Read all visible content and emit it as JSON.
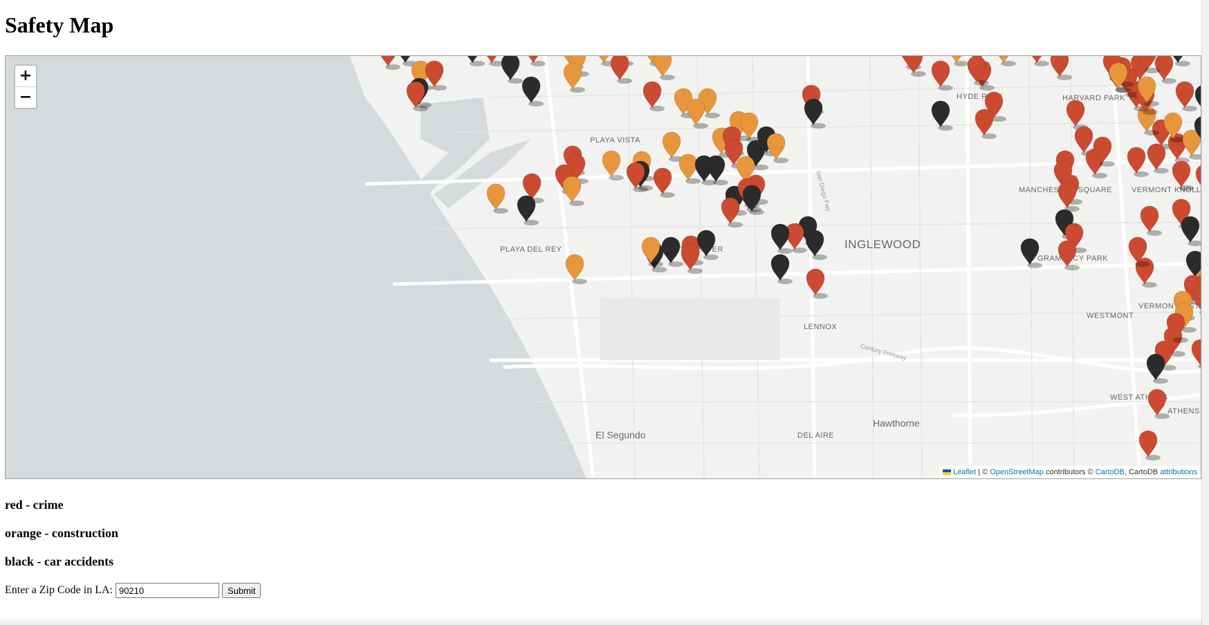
{
  "page": {
    "title": "Safety Map"
  },
  "map": {
    "zoom_in_label": "+",
    "zoom_out_label": "−",
    "place_labels": [
      "PLAYA VISTA",
      "PLAYA DEL REY",
      "WESTCHESTER",
      "INGLEWOOD",
      "HYDE PARK",
      "HARVARD PARK",
      "MANCHESTER SQUARE",
      "VERMONT KNOLLS",
      "GRAMERCY PARK",
      "WESTMONT",
      "VERMONT VISTA",
      "LENNOX",
      "WEST ATHENS",
      "ATHENS",
      "El Segundo",
      "Hawthorne",
      "DEL AIRE",
      "Century Freeway",
      "San Diego Fwy"
    ],
    "attribution": {
      "leaflet": "Leaflet",
      "sep": " | © ",
      "osm": "OpenStreetMap",
      "contributors": " contributors © ",
      "cartodb_link": "CartoDB",
      "cartodb_text": ", CartoDB ",
      "attributions": "attributions"
    },
    "marker_colors": {
      "crime": "#cc4a30",
      "construction": "#e8963c",
      "accident": "#2b2b2b"
    }
  },
  "legend": {
    "red": "red - crime",
    "orange": "orange - construction",
    "black": "black - car accidents"
  },
  "zip_form": {
    "label": "Enter a Zip Code in LA:",
    "value": "90210",
    "submit_label": "Submit"
  }
}
